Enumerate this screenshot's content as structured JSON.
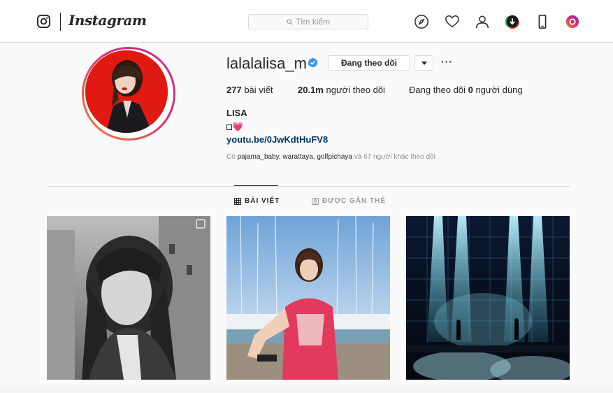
{
  "nav": {
    "brand": "Instagram",
    "search_placeholder": "Tìm kiếm",
    "icons": [
      "instagram-logo-icon",
      "search-icon",
      "compass-icon",
      "heart-icon",
      "person-icon",
      "download-icon",
      "mobile-icon",
      "extension-icon"
    ]
  },
  "profile": {
    "username": "lalalalisa_m",
    "verified": true,
    "follow_label": "Đang theo dõi",
    "more_label": "···",
    "stats": {
      "posts_value": "277",
      "posts_label": "bài viết",
      "followers_value": "20.1m",
      "followers_label": "người theo dõi",
      "following_prefix": "Đang theo dõi",
      "following_value": "0",
      "following_label": "người dùng"
    },
    "full_name": "LISA",
    "bio_emoji": "💗",
    "link": "youtu.be/0JwKdtHuFV8",
    "followed_by": {
      "prefix": "Có",
      "names": "pajama_baby, warattaya, golfpichaya",
      "suffix": "và 67 người khác theo dõi"
    }
  },
  "tabs": [
    {
      "label": "BÀI VIẾT",
      "active": true
    },
    {
      "label": "ĐƯỢC GẮN THẺ",
      "active": false
    }
  ],
  "posts": [
    {
      "subject": "black-and-white portrait"
    },
    {
      "subject": "marina portrait in pink shirt"
    },
    {
      "subject": "concert stage lights"
    }
  ],
  "colors": {
    "link": "#003569",
    "verified": "#3897f0",
    "ring_start": "#f58529",
    "ring_end": "#c13584"
  }
}
